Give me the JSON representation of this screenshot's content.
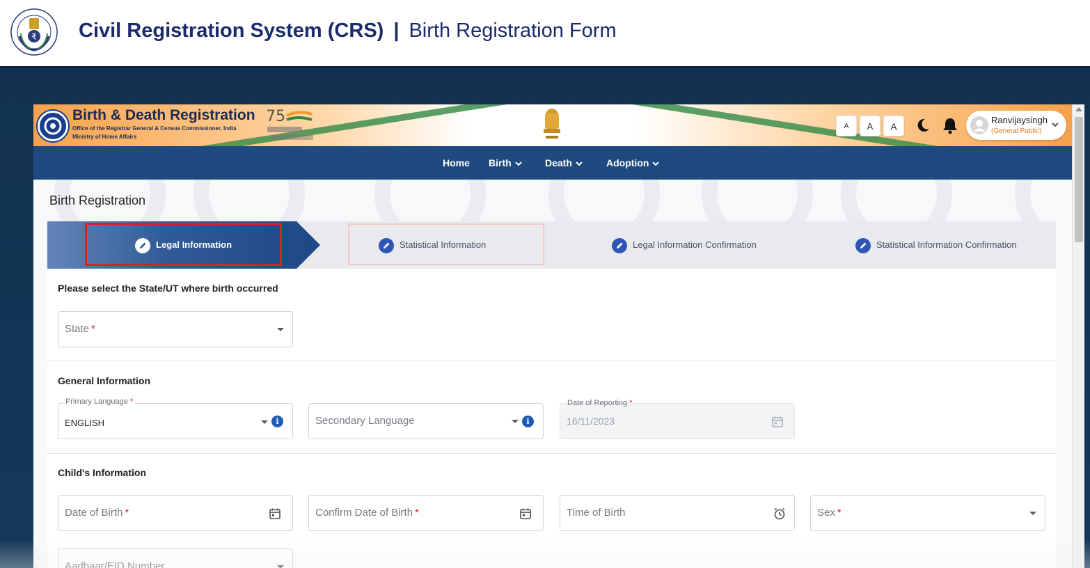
{
  "banner": {
    "title": "Civil Registration System (CRS)",
    "separator": "|",
    "subtitle": "Birth Registration Form"
  },
  "app_header": {
    "title": "Birth & Death Registration",
    "subtitle_line1": "Office of the Registrar General & Census Commissioner, India",
    "subtitle_line2": "Ministry of Home Affairs",
    "font_small": "A",
    "font_normal": "A",
    "font_large": "A",
    "user_name": "Ranvijaysingh",
    "user_role": "(General Public)"
  },
  "nav": {
    "items": [
      {
        "label": "Home"
      },
      {
        "label": "Birth"
      },
      {
        "label": "Death"
      },
      {
        "label": "Adoption"
      }
    ]
  },
  "page": {
    "heading": "Birth Registration"
  },
  "stepper": {
    "steps": [
      {
        "label": "Legal Information",
        "active": true
      },
      {
        "label": "Statistical Information",
        "active": false
      },
      {
        "label": "Legal Information Confirmation",
        "active": false
      },
      {
        "label": "Statistical Information Confirmation",
        "active": false
      }
    ]
  },
  "form": {
    "state_section": {
      "title": "Please select the State/UT where birth occurred",
      "state_placeholder": "State",
      "required_mark": "*"
    },
    "general_section": {
      "title": "General Information",
      "primary_language_label": "Primary Language",
      "primary_language_value": "ENGLISH",
      "secondary_language_placeholder": "Secondary Language",
      "date_of_reporting_label": "Date of Reporting",
      "date_of_reporting_value": "16/11/2023",
      "info_glyph": "i",
      "required_mark": "*"
    },
    "child_section": {
      "title": "Child's Information",
      "dob_placeholder": "Date of Birth",
      "confirm_dob_placeholder": "Confirm Date of Birth",
      "time_of_birth_placeholder": "Time of Birth",
      "sex_placeholder": "Sex",
      "aadhaar_placeholder": "Aadhaar/EID Number",
      "required_mark": "*"
    }
  },
  "colors": {
    "brand_navy": "#1b2a6b",
    "nav_blue": "#1e4a80",
    "stepper_active": "#2a5a9a",
    "highlight_red": "#d6202a",
    "info_blue": "#1f5bb5",
    "saffron": "#f6a24b",
    "india_green": "#3e8e4e"
  }
}
